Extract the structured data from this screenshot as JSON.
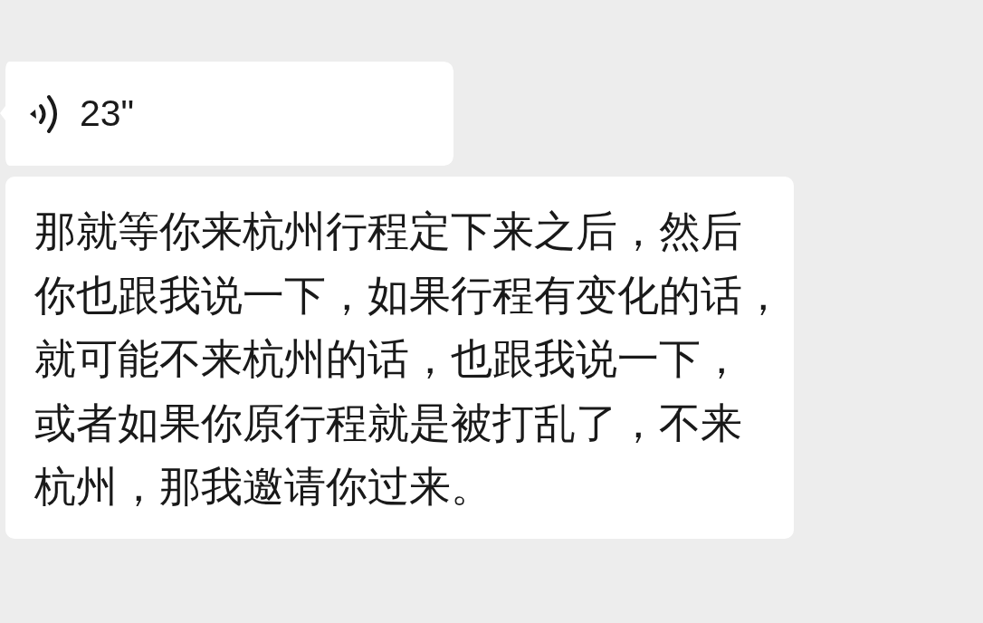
{
  "messages": [
    {
      "kind": "voice",
      "duration": "23\""
    },
    {
      "kind": "transcript",
      "lines": [
        "那就等你来杭州行程定下来之后，然后",
        "你也跟我说一下，如果行程有变化的话，",
        "就可能不来杭州的话，也跟我说一下，",
        "或者如果你原行程就是被打乱了，不来",
        "杭州，那我邀请你过来。"
      ]
    }
  ]
}
